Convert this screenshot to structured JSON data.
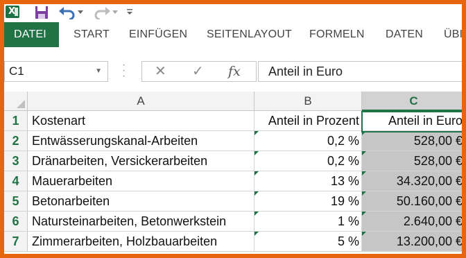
{
  "qat": {
    "icons": [
      "excel-logo-icon",
      "save-icon",
      "undo-icon",
      "redo-icon",
      "customize-qat-icon"
    ],
    "logo_letter": "X"
  },
  "ribbon": {
    "tabs": [
      {
        "label": "DATEI",
        "active": true
      },
      {
        "label": "START"
      },
      {
        "label": "EINFÜGEN"
      },
      {
        "label": "SEITENLAYOUT"
      },
      {
        "label": "FORMELN"
      },
      {
        "label": "DATEN"
      },
      {
        "label": "ÜBI"
      }
    ]
  },
  "formula_bar": {
    "name_box": "C1",
    "formula_value": "Anteil in Euro",
    "fx_label": "fx"
  },
  "grid": {
    "columns": [
      "A",
      "B",
      "C"
    ],
    "selected_column": "C",
    "rows": [
      {
        "num": "1",
        "a": "Kostenart",
        "b": "Anteil in Prozent",
        "c": "Anteil in Euro"
      },
      {
        "num": "2",
        "a": "Entwässerungskanal-Arbeiten",
        "b": "0,2 %",
        "c": "528,00 €"
      },
      {
        "num": "3",
        "a": "Dränarbeiten, Versickerarbeiten",
        "b": "0,2 %",
        "c": "528,00 €"
      },
      {
        "num": "4",
        "a": "Mauerarbeiten",
        "b": "13 %",
        "c": "34.320,00 €"
      },
      {
        "num": "5",
        "a": "Betonarbeiten",
        "b": "19 %",
        "c": "50.160,00 €"
      },
      {
        "num": "6",
        "a": "Natursteinarbeiten, Betonwerkstein",
        "b": "1 %",
        "c": "2.640,00 €"
      },
      {
        "num": "7",
        "a": "Zimmerarbeiten, Holzbauarbeiten",
        "b": "5 %",
        "c": "13.200,00 €"
      }
    ]
  },
  "colors": {
    "frame": "#e8650f",
    "excel_green": "#217346",
    "selected_fill": "#c6c6c6"
  }
}
